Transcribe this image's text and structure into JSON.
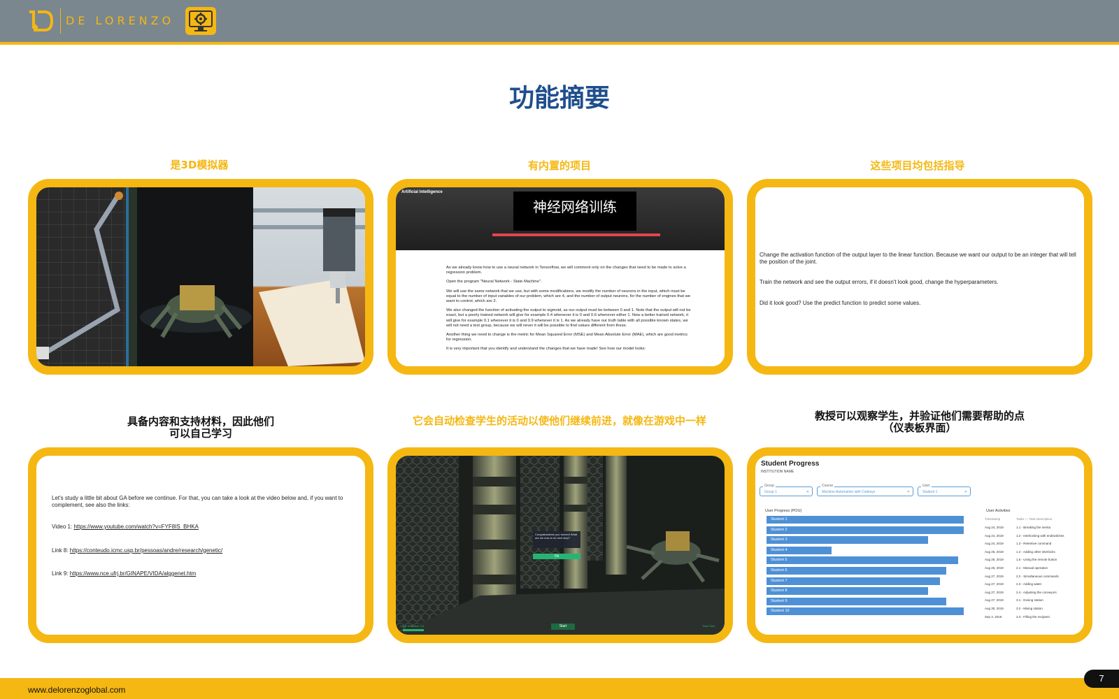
{
  "header": {
    "brand": "DE LORENZO",
    "colors": {
      "bar": "#7a878f",
      "accent": "#f5b712",
      "title": "#1f4e8c"
    }
  },
  "title": "功能摘要",
  "captions": [
    "是3D模拟器",
    "有内置的项目",
    "这些项目均包括指导",
    "具备内容和支持材料，因此他们可以自己学习",
    "它会自动检查学生的活动以使他们继续前进，就像在游戏中一样",
    "教授可以观察学生，并验证他们需要帮助的点（仪表板界面）"
  ],
  "panel2": {
    "tag": "Artificial Intelligence",
    "banner": "神经网络训练",
    "paragraphs": [
      "As we already know how to use a neural network in Tensorflow, we will comment only on the changes that need to be made to solve a regression problem.",
      "Open the program \"Neural Network - State Machine\".",
      "We will use the same network that we use, but with some modifications, we modify the number of neurons in the input, which must be equal to the number of input variables of our problem, which are 4, and the number of output neurons, for the number of engines that we want to control, which are 2.",
      "We also changed the function of activating the output to sigmoid, as our output must be between 0 and 1. Note that the output will not be exact, but a poorly trained network will give for example 0.4 whenever it is 0 and 0.6 whenever either 1. Now a better trained network, it will give for example 0.1 whenever it is 0 and 0.9 whenever it is 1. As we already have our truth table with all possible known states, we will not need a test group, because we will never it will be possible to find values different from these.",
      "Another thing we need to change is the metric for Mean Squared Error (MSE) and Mean Absolute Error (MAE), which are good metrics for regression.",
      "It is very important that you identify and understand the changes that we have made! See how our model looks:"
    ]
  },
  "panel3": {
    "paragraphs": [
      "Change the activation function of the output layer to the linear function. Because we want our output to be an integer that will tell the position of the joint.",
      "Train the network and see the output errors, if it doesn't look good, change the hyperparameters.",
      "Did it look good? Use the predict function to predict some values."
    ]
  },
  "panel4": {
    "intro": "Let's study a little bit about GA before we continue. For that, you can take a look at the video below and, if you want to complement, see also the links:",
    "links": [
      {
        "label": "Video 1: ",
        "url": "https://www.youtube.com/watch?v=FYF8IS_BHKA"
      },
      {
        "label": "Link 8: ",
        "url": "https://conteudo.icmc.usp.br/pessoas/andre/research/genetic/"
      },
      {
        "label": "Link 9: ",
        "url": "https://www.nce.ufrj.br/GINAPE/VIDA/alggenet.htm"
      }
    ]
  },
  "panel5": {
    "dialog_text": "Congratulations you moved! What are we now to do next step?",
    "dialog_button": "Ok",
    "start_button": "Start",
    "left_status": "Level Selected: 1/3",
    "right_status": "Total Time"
  },
  "dashboard": {
    "title": "Student Progress",
    "institution": "INSTITUTION NAME",
    "filters": [
      {
        "label": "Group",
        "value": "Group 1"
      },
      {
        "label": "Course",
        "value": "Machine Automation with Codesys"
      },
      {
        "label": "User",
        "value": "Student 1"
      }
    ],
    "progress_title": "User Progress (POU)",
    "students": [
      {
        "name": "Student 1",
        "progress": 1.0
      },
      {
        "name": "Student 2",
        "progress": 1.0
      },
      {
        "name": "Student 3",
        "progress": 0.82
      },
      {
        "name": "Student 4",
        "progress": 0.33
      },
      {
        "name": "Student 5",
        "progress": 0.97
      },
      {
        "name": "Student 6",
        "progress": 0.91
      },
      {
        "name": "Student 7",
        "progress": 0.88
      },
      {
        "name": "Student 8",
        "progress": 0.82
      },
      {
        "name": "Student 9",
        "progress": 0.91
      },
      {
        "name": "Student 10",
        "progress": 1.0
      }
    ],
    "activities_title": "User Activities",
    "activities_header": [
      "Timestamp",
      "Tasks — Task Description"
    ],
    "activities": [
      {
        "date": "Aug 24, 2019",
        "task": "1.1 - Breaking the inertia"
      },
      {
        "date": "Aug 24, 2019",
        "task": "1.2 - Interlocking with endswitches"
      },
      {
        "date": "Aug 24, 2019",
        "task": "1.3 - Retentive command"
      },
      {
        "date": "Aug 26, 2019",
        "task": "1.4 - Adding other interlocks"
      },
      {
        "date": "Aug 26, 2019",
        "task": "1.5 - Using the remote button"
      },
      {
        "date": "Aug 26, 2019",
        "task": "2.1 - Manual operation"
      },
      {
        "date": "Aug 27, 2019",
        "task": "2.2 - Simultaneous commands"
      },
      {
        "date": "Aug 27, 2019",
        "task": "2.3 - Adding water"
      },
      {
        "date": "Aug 27, 2019",
        "task": "2.4 - Adjusting the conveyors"
      },
      {
        "date": "Aug 27, 2019",
        "task": "3.1 - Dosing station"
      },
      {
        "date": "Aug 30, 2019",
        "task": "3.2 - Mixing station"
      },
      {
        "date": "Sep 3, 2019",
        "task": "3.3 - Filling the recipient"
      }
    ]
  },
  "footer": {
    "url": "www.delorenzoglobal.com",
    "page": "7"
  }
}
